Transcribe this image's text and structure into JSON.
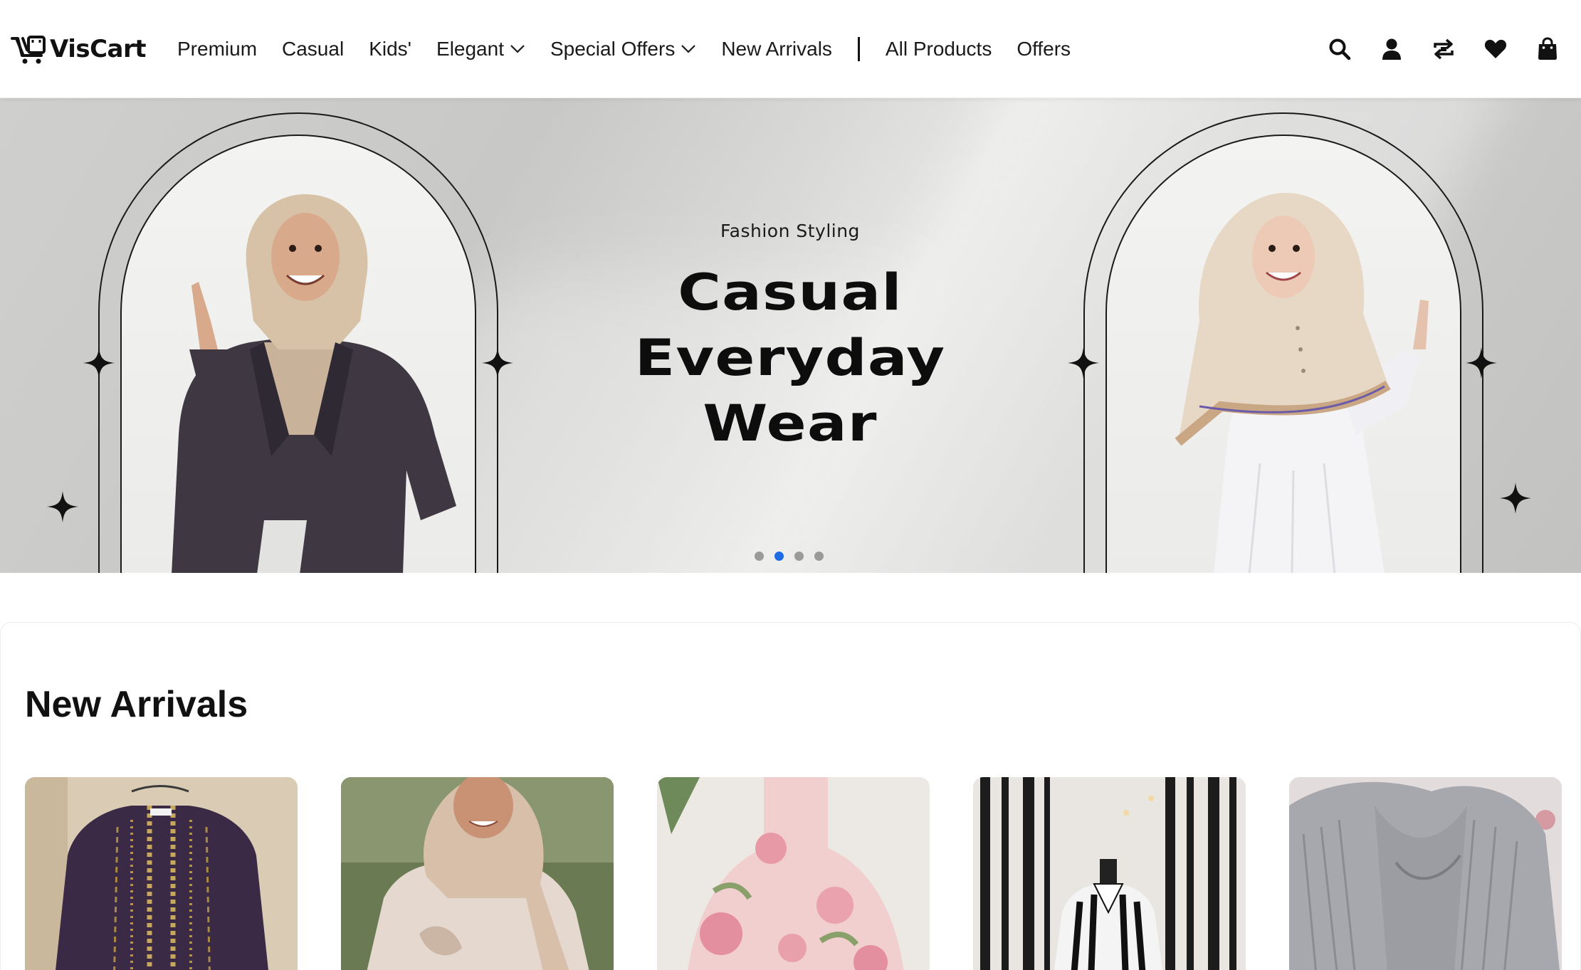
{
  "brand": {
    "name": "VisCart",
    "logo_icon": "cart-logo-icon"
  },
  "nav": {
    "items": [
      {
        "label": "Premium",
        "has_dropdown": false
      },
      {
        "label": "Casual",
        "has_dropdown": false
      },
      {
        "label": "Kids'",
        "has_dropdown": false
      },
      {
        "label": "Elegant",
        "has_dropdown": true
      },
      {
        "label": "Special Offers",
        "has_dropdown": true
      },
      {
        "label": "New Arrivals",
        "has_dropdown": false
      }
    ],
    "secondary": [
      {
        "label": "All Products"
      },
      {
        "label": "Offers"
      }
    ]
  },
  "header_icons": [
    "search-icon",
    "user-icon",
    "compare-icon",
    "wishlist-heart-icon",
    "shopping-bag-icon"
  ],
  "hero": {
    "subtitle": "Fashion Styling",
    "title_lines": [
      "Casual",
      "Everyday",
      "Wear"
    ],
    "slides": 4,
    "active_slide": 2,
    "active_dot_color": "#1e6be6"
  },
  "new_arrivals": {
    "title": "New Arrivals",
    "products": [
      {
        "image": "purple-embroidered-abaya"
      },
      {
        "image": "beige-hijab-model"
      },
      {
        "image": "pink-floral-dress"
      },
      {
        "image": "striped-shirt-mannequin"
      },
      {
        "image": "grey-pleated-cape"
      }
    ]
  }
}
